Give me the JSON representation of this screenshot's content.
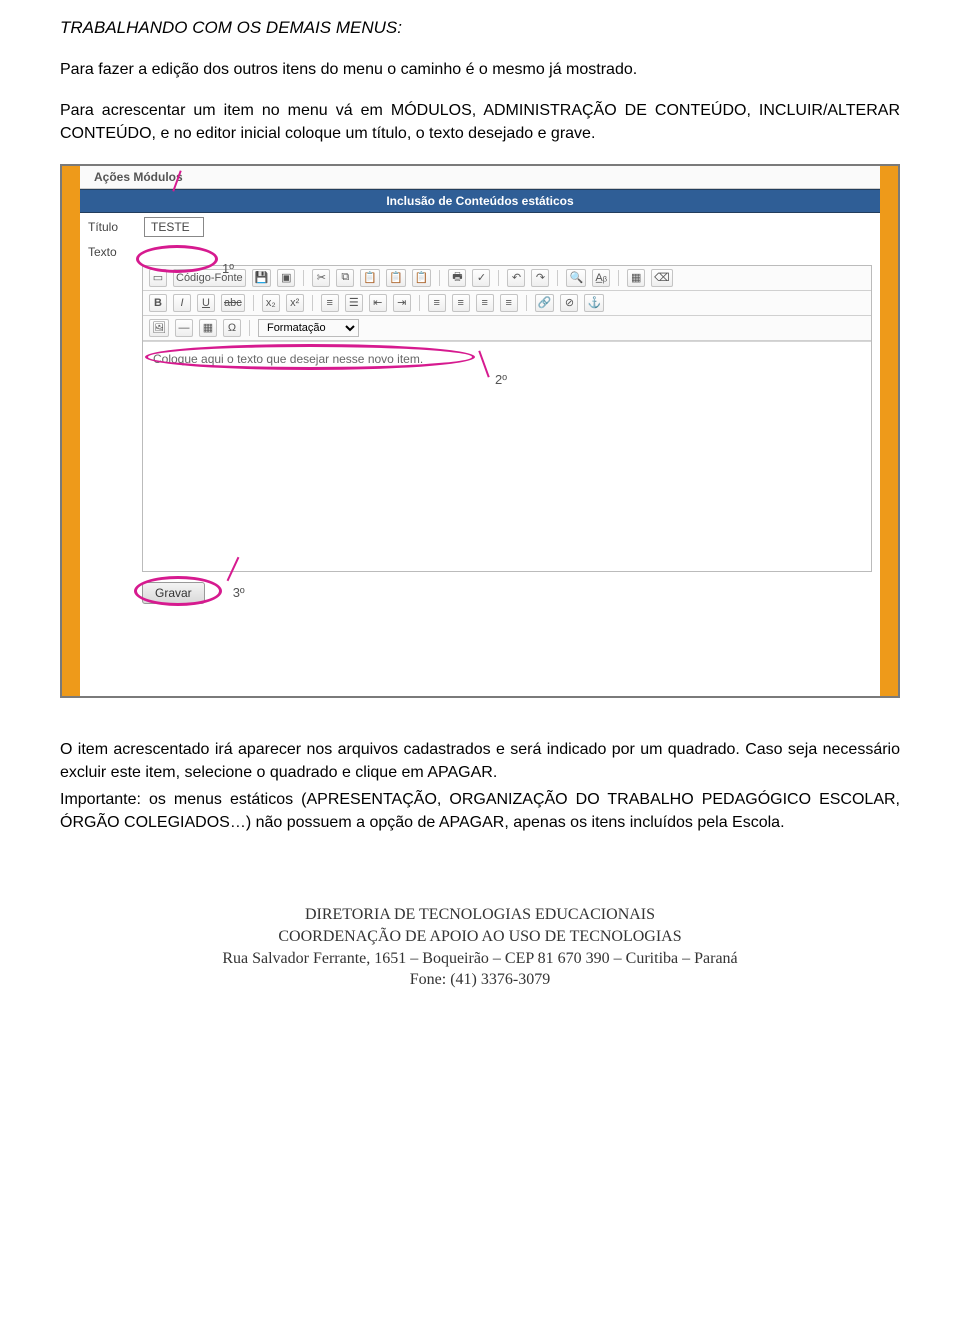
{
  "section_heading": "TRABALHANDO COM OS DEMAIS MENUS:",
  "para1": "Para fazer a edição dos outros itens do menu o caminho é o mesmo já mostrado.",
  "para2": "Para acrescentar um item no menu vá em MÓDULOS, ADMINISTRAÇÃO DE CONTEÚDO, INCLUIR/ALTERAR CONTEÚDO, e no editor inicial coloque um título, o texto desejado e grave.",
  "screenshot": {
    "menu_strip": "Ações    Módulos",
    "blue_bar": "Inclusão de Conteúdos estáticos",
    "label_titulo": "Título",
    "titulo_value": "TESTE",
    "label_texto": "Texto",
    "toolbar1": {
      "source_label": "Código-Fonte",
      "icons": [
        "new-doc",
        "save",
        "preview",
        "cut",
        "copy",
        "paste",
        "paste-word",
        "paste-plain",
        "print",
        "spellcheck",
        "undo",
        "redo",
        "find",
        "replace",
        "select-all",
        "table"
      ]
    },
    "toolbar2": {
      "icons": [
        "bold",
        "italic",
        "underline",
        "strike",
        "subscript",
        "superscript",
        "ol",
        "ul",
        "outdent",
        "indent",
        "align-left",
        "align-center",
        "align-right",
        "justify",
        "link",
        "unlink",
        "anchor"
      ]
    },
    "toolbar3": {
      "icons": [
        "image",
        "hr",
        "smiley",
        "special-char"
      ],
      "format_label": "Formatação"
    },
    "editor_placeholder": "Coloque aqui o texto que desejar nesse novo item.",
    "gravar_label": "Gravar",
    "step1": "1º",
    "step2": "2º",
    "step3": "3º"
  },
  "para3": "O item acrescentado irá aparecer nos arquivos cadastrados e será indicado por um quadrado. Caso seja necessário excluir este item, selecione o quadrado e clique em APAGAR.",
  "para4": "Importante: os menus estáticos (APRESENTAÇÃO, ORGANIZAÇÃO DO TRABALHO PEDAGÓGICO ESCOLAR, ÓRGÃO COLEGIADOS…) não possuem a opção de APAGAR, apenas os itens incluídos pela Escola.",
  "footer": {
    "line1": "DIRETORIA DE TECNOLOGIAS EDUCACIONAIS",
    "line2": "COORDENAÇÃO DE APOIO AO USO DE TECNOLOGIAS",
    "line3": "Rua Salvador Ferrante, 1651 – Boqueirão – CEP 81 670 390 – Curitiba – Paraná",
    "line4": "Fone: (41) 3376-3079"
  }
}
